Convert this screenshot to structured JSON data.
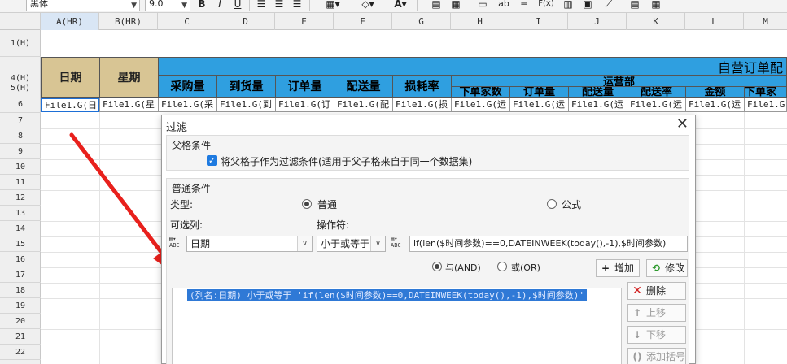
{
  "toolbar": {
    "font_name": "黑体",
    "font_size": "9.0",
    "bold": "B",
    "italic": "I",
    "underline": "U",
    "text_btn": "ab",
    "formula_btn": "F(x)"
  },
  "grid": {
    "columns": [
      "A(HR)",
      "B(HR)",
      "C",
      "D",
      "E",
      "F",
      "G",
      "H",
      "I",
      "J",
      "K",
      "L",
      "M"
    ],
    "rows": [
      "1(H)",
      "4(H)",
      "5(H)",
      "6",
      "7",
      "8",
      "9",
      "10",
      "11",
      "12",
      "13",
      "14",
      "15",
      "16",
      "17",
      "18",
      "19",
      "20",
      "21",
      "22"
    ],
    "header_date": "日期",
    "header_weekday": "星期",
    "group_title": "自营订单配",
    "ops_dept": "运营部",
    "sub_headers": [
      "采购量",
      "到货量",
      "订单量",
      "配送量",
      "损耗率"
    ],
    "ops_sub_headers": [
      "下单家数",
      "订单量",
      "配送量",
      "配送率",
      "金额",
      "下单家"
    ],
    "data_cells": [
      "File1.G(日",
      "File1.G(星",
      "File1.G(采",
      "File1.G(到",
      "File1.G(订",
      "File1.G(配",
      "File1.G(损",
      "File1.G(运",
      "File1.G(运",
      "File1.G(运",
      "File1.G(运",
      "File1.G(运",
      "File1.G("
    ]
  },
  "dialog": {
    "title": "过滤",
    "parent_section": "父格条件",
    "parent_checkbox": "将父格子作为过滤条件(适用于父子格来自于同一个数据集)",
    "normal_section": "普通条件",
    "type_label": "类型:",
    "type_normal": "普通",
    "type_formula": "公式",
    "column_label": "可选列:",
    "column_value": "日期",
    "operator_label": "操作符:",
    "operator_value": "小于或等于",
    "value_text": "if(len($时间参数)==0,DATEINWEEK(today(),-1),$时间参数)",
    "and_label": "与(AND)",
    "or_label": "或(OR)",
    "add_button": "增加",
    "modify_button": "修改",
    "delete_button": "删除",
    "move_up_button": "上移",
    "move_down_button": "下移",
    "add_bracket_button": "添加括号",
    "condition_item": "(列名:日期) 小于或等于 'if(len($时间参数)==0,DATEINWEEK(today(),-1),$时间参数)'"
  },
  "colors": {
    "header_tan": "#d8c594",
    "header_blue": "#2f9fe0",
    "arrow_red": "#e8201c",
    "selection_blue": "#2f79d6"
  }
}
